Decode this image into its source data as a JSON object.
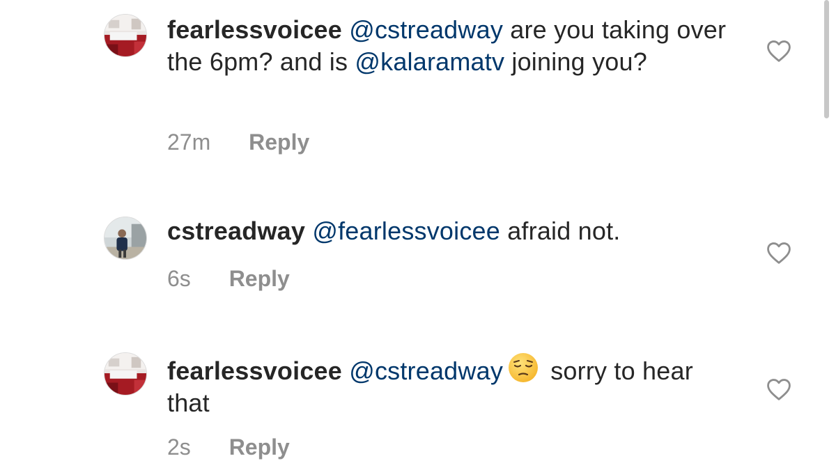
{
  "comments": [
    {
      "username": "fearlessvoicee",
      "mention": "@cstreadway",
      "text_1": " are you taking over the 6pm? and is ",
      "mention_2": "@kalaramatv",
      "text_2": " joining you?",
      "time": "27m",
      "reply_label": "Reply",
      "avatar_icon": "avatar-room-photo",
      "like_icon": "heart-outline-icon"
    },
    {
      "username": "cstreadway",
      "mention": "@fearlessvoicee",
      "text_1": " afraid not.",
      "time": "6s",
      "reply_label": "Reply",
      "avatar_icon": "avatar-person-photo",
      "like_icon": "heart-outline-icon"
    },
    {
      "username": "fearlessvoicee",
      "mention": "@cstreadway",
      "emoji": "pensive-face-emoji",
      "text_1": " sorry to hear that",
      "time": "2s",
      "reply_label": "Reply",
      "avatar_icon": "avatar-room-photo",
      "like_icon": "heart-outline-icon"
    }
  ],
  "colors": {
    "text": "#262626",
    "mention": "#00376b",
    "meta": "#8e8e8e",
    "background": "#ffffff"
  }
}
